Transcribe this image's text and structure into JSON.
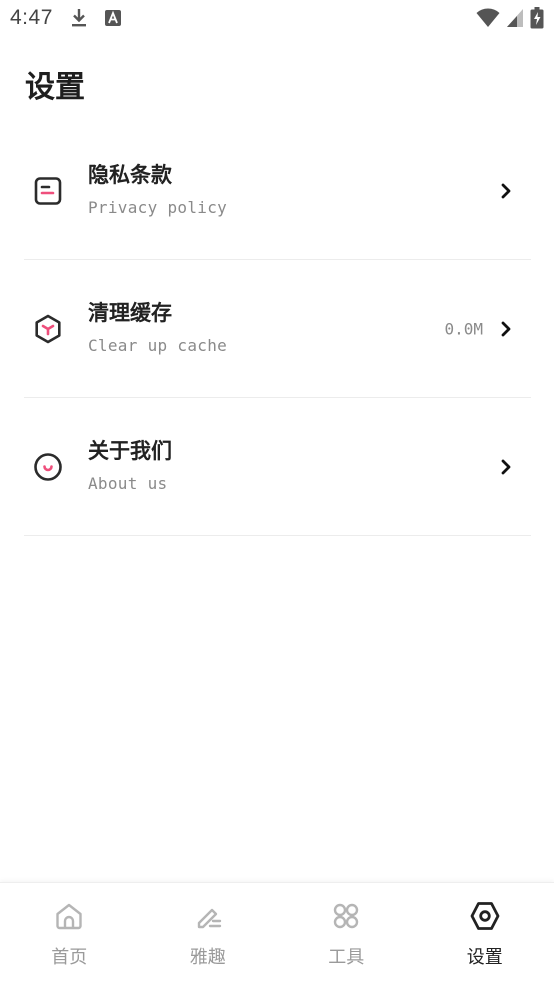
{
  "status_bar": {
    "time": "4:47"
  },
  "page": {
    "title": "设置"
  },
  "settings": {
    "items": [
      {
        "title": "隐私条款",
        "subtitle": "Privacy policy",
        "icon": "document-icon",
        "value": ""
      },
      {
        "title": "清理缓存",
        "subtitle": "Clear up cache",
        "icon": "hexagon-y-icon",
        "value": "0.0M"
      },
      {
        "title": "关于我们",
        "subtitle": "About us",
        "icon": "smile-circle-icon",
        "value": ""
      }
    ]
  },
  "bottom_nav": {
    "items": [
      {
        "label": "首页",
        "icon": "home-icon",
        "active": false
      },
      {
        "label": "雅趣",
        "icon": "pen-icon",
        "active": false
      },
      {
        "label": "工具",
        "icon": "grid-icon",
        "active": false
      },
      {
        "label": "设置",
        "icon": "settings-hexagon-icon",
        "active": true
      }
    ]
  },
  "colors": {
    "accent": "#ef4f7c",
    "icon_dark": "#2b2b2b",
    "inactive": "#b5b5b5",
    "text_secondary": "#8a8a8a"
  }
}
